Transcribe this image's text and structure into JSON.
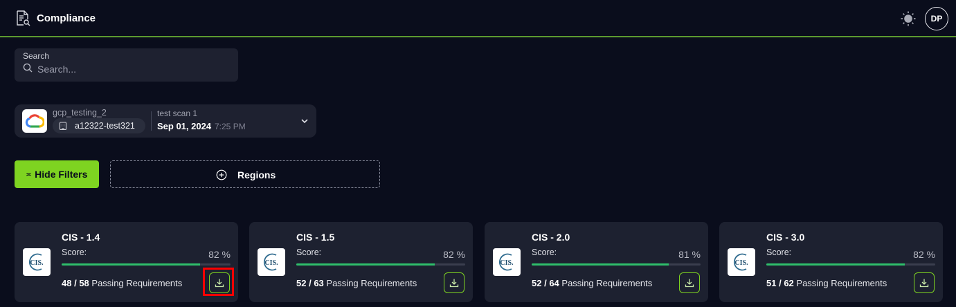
{
  "header": {
    "title": "Compliance",
    "avatar_initials": "DP",
    "accent_color": "#7ed321"
  },
  "search": {
    "label": "Search",
    "placeholder": "Search..."
  },
  "account": {
    "name": "gcp_testing_2",
    "id": "a12322-test321",
    "scan_name": "test scan 1",
    "scan_date": "Sep 01, 2024",
    "scan_time": "7:25 PM",
    "provider_icon": "google-cloud-icon"
  },
  "filters": {
    "hide_label": "Hide Filters",
    "regions_label": "Regions"
  },
  "cards": [
    {
      "title": "CIS - 1.4",
      "score_label": "Score:",
      "score": "82 %",
      "score_value": 82,
      "passing": "48",
      "total": "58",
      "passing_label": "Passing Requirements",
      "logo_text": "CIS."
    },
    {
      "title": "CIS - 1.5",
      "score_label": "Score:",
      "score": "82 %",
      "score_value": 82,
      "passing": "52",
      "total": "63",
      "passing_label": "Passing Requirements",
      "logo_text": "CIS."
    },
    {
      "title": "CIS - 2.0",
      "score_label": "Score:",
      "score": "81 %",
      "score_value": 81,
      "passing": "52",
      "total": "64",
      "passing_label": "Passing Requirements",
      "logo_text": "CIS."
    },
    {
      "title": "CIS - 3.0",
      "score_label": "Score:",
      "score": "82 %",
      "score_value": 82,
      "passing": "51",
      "total": "62",
      "passing_label": "Passing Requirements",
      "logo_text": "CIS."
    }
  ]
}
